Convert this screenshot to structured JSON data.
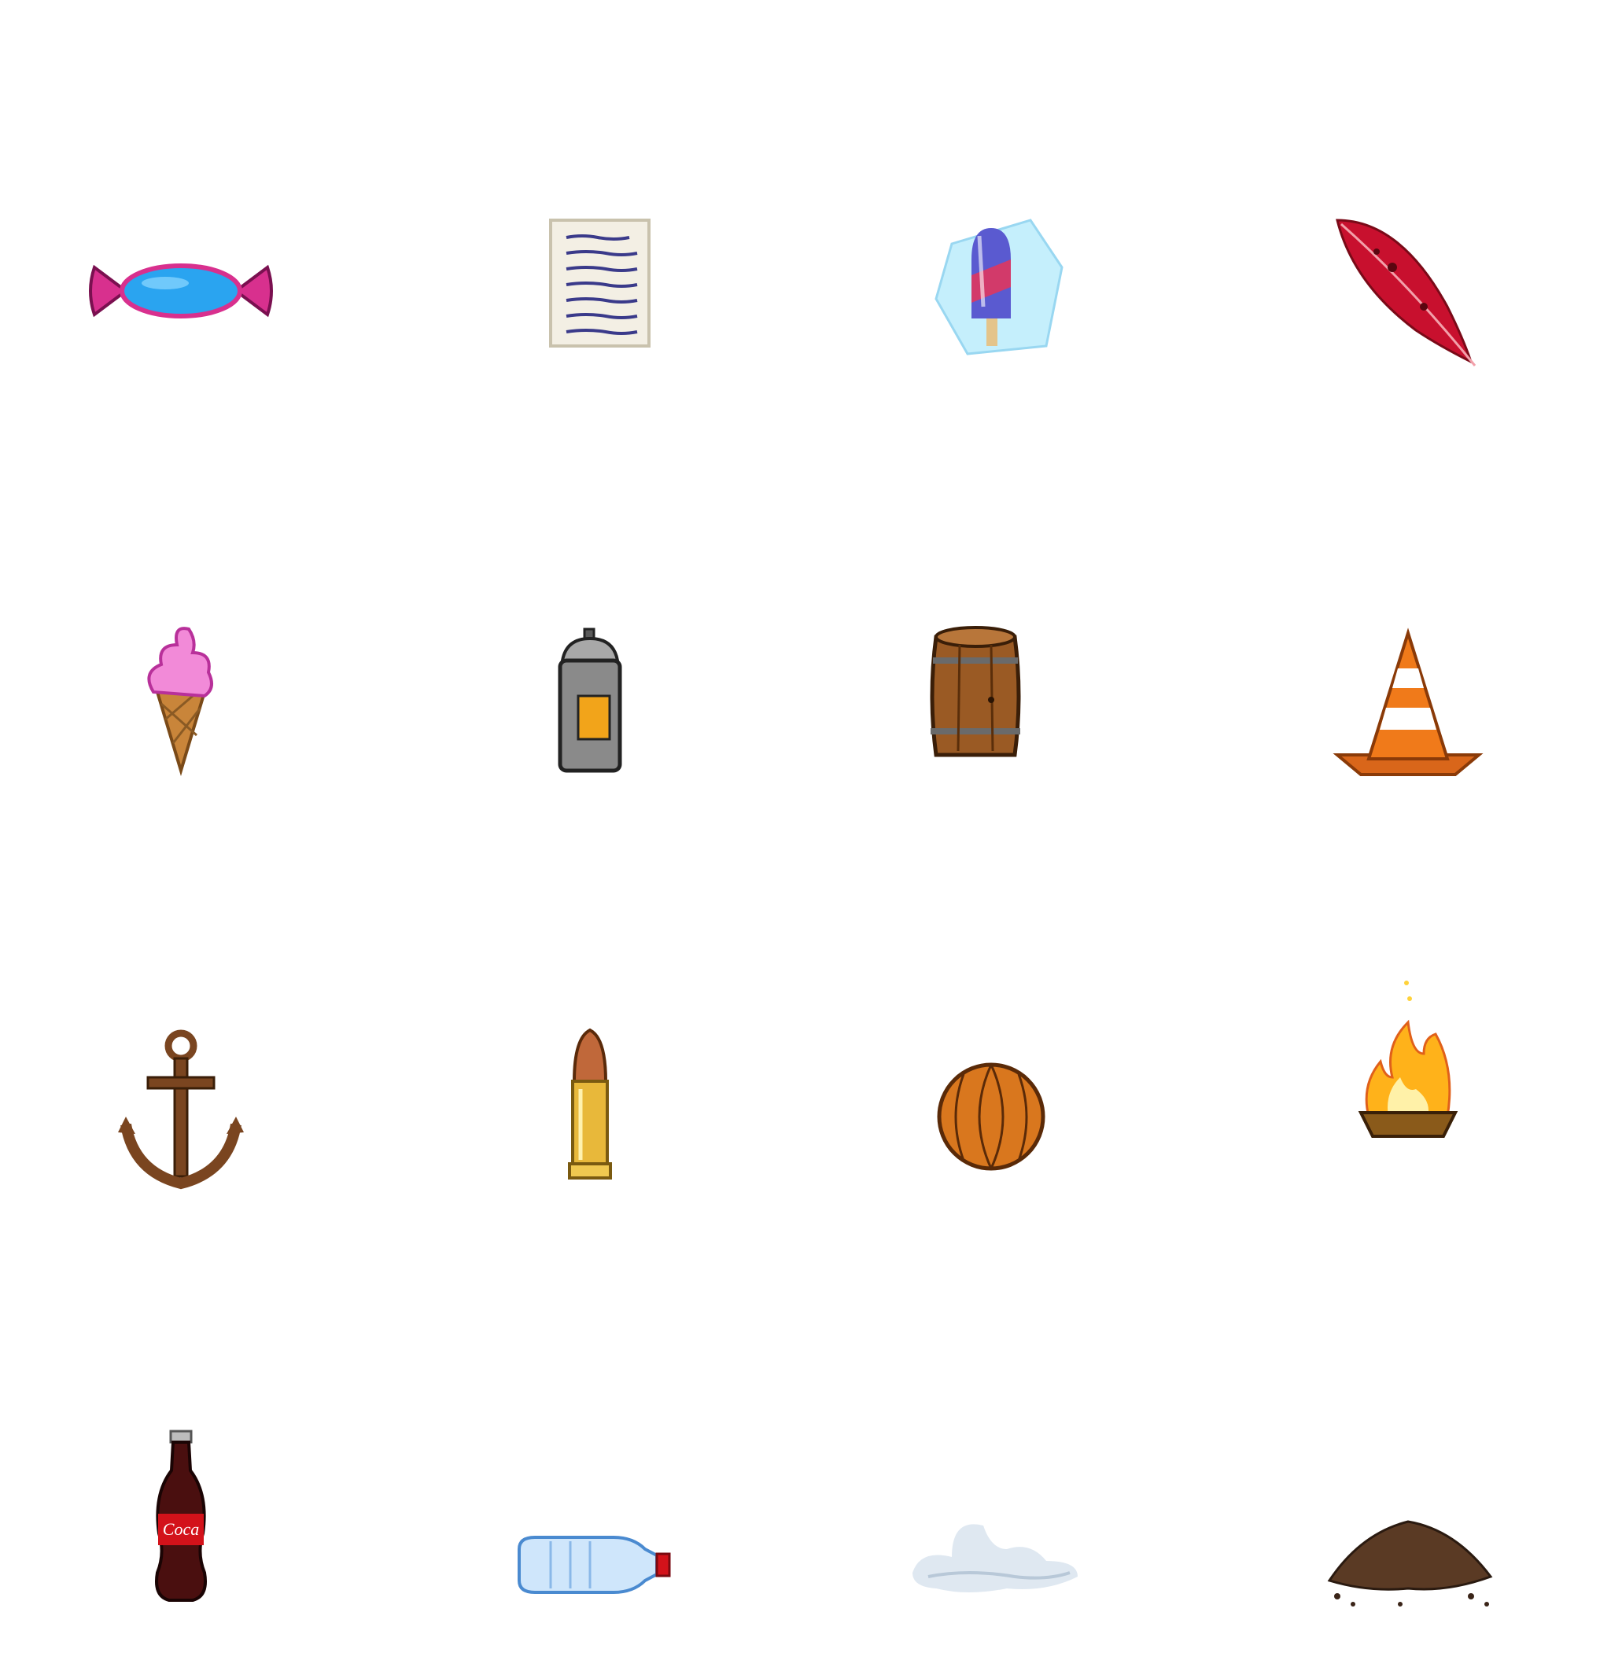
{
  "sheet": {
    "background": "#ffffff",
    "sprites": [
      {
        "icon": "candy-icon"
      },
      {
        "icon": "paper-note-icon"
      },
      {
        "icon": "frozen-popsicle-icon"
      },
      {
        "icon": "red-feather-icon"
      },
      {
        "icon": "ice-cream-cone-icon"
      },
      {
        "icon": "spray-can-icon"
      },
      {
        "icon": "wooden-barrel-icon"
      },
      {
        "icon": "traffic-cone-icon"
      },
      {
        "icon": "anchor-icon"
      },
      {
        "icon": "bullet-icon"
      },
      {
        "icon": "leather-ball-icon"
      },
      {
        "icon": "fire-brazier-icon"
      },
      {
        "icon": "cola-bottle-icon",
        "label": "Coca"
      },
      {
        "icon": "water-bottle-icon"
      },
      {
        "icon": "cloud-icon"
      },
      {
        "icon": "dirt-pile-icon"
      }
    ]
  },
  "colors": {
    "candy": "#2aa4f0",
    "candy_wrapper": "#d8308e",
    "paper": "#f3efe4",
    "ink": "#3a3a8a",
    "popsicle_ice": "#bfeefc",
    "popsicle_red": "#d23a6a",
    "popsicle_blue": "#5a5ad0",
    "feather": "#c8102e",
    "ice_cream": "#f28ad8",
    "cone": "#c9853a",
    "spray_body": "#8a8a8a",
    "spray_label": "#f2a41a",
    "barrel": "#9a5a24",
    "traffic_cone": "#f07a1a",
    "anchor": "#7a4520",
    "bullet_tip": "#c0683a",
    "bullet_case": "#e8b83a",
    "ball": "#d9771e",
    "flame": "#ffb21a",
    "bowl": "#8a5a1a",
    "cola": "#4a0f0f",
    "cola_label": "#d3121a",
    "water_bottle": "#cfe6fb",
    "cap": "#d3121a",
    "cloud": "#dce6f0",
    "dirt": "#5a3a24"
  }
}
